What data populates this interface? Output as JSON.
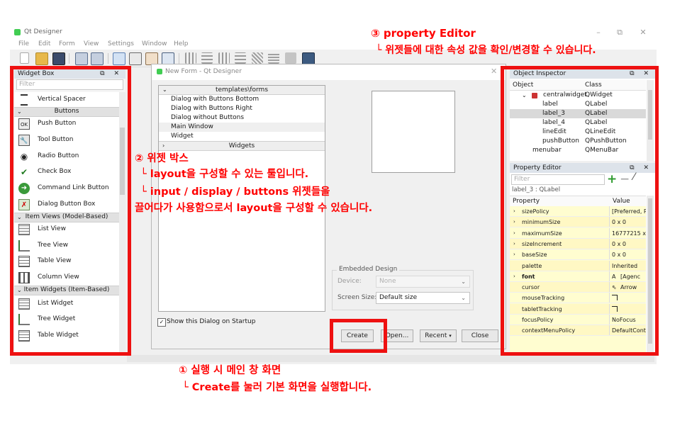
{
  "window": {
    "title": "Qt Designer",
    "controls": {
      "minimize": "–",
      "maximize": "⧉",
      "close": "✕"
    },
    "menu": [
      "File",
      "Edit",
      "Form",
      "View",
      "Settings",
      "Window",
      "Help"
    ]
  },
  "widget_box": {
    "title": "Widget Box",
    "buttons": "⧉ ✕",
    "filter_placeholder": "Filter",
    "spacer_item": {
      "label": "Vertical Spacer",
      "icon": "vertical-spacer-icon"
    },
    "cat_buttons": "Buttons",
    "buttons_items": [
      {
        "label": "Push Button",
        "icon": "push-button-icon",
        "glyph": "OK"
      },
      {
        "label": "Tool Button",
        "icon": "tool-button-icon",
        "glyph": "🔧"
      },
      {
        "label": "Radio Button",
        "icon": "radio-button-icon",
        "glyph": "◉"
      },
      {
        "label": "Check Box",
        "icon": "check-box-icon",
        "glyph": "✔"
      },
      {
        "label": "Command Link Button",
        "icon": "command-link-icon",
        "glyph": "➜"
      },
      {
        "label": "Dialog Button Box",
        "icon": "dialog-button-box-icon",
        "glyph": "✗"
      }
    ],
    "cat_item_views": "Item Views (Model-Based)",
    "item_views": [
      {
        "label": "List View",
        "icon": "list-view-icon"
      },
      {
        "label": "Tree View",
        "icon": "tree-view-icon"
      },
      {
        "label": "Table View",
        "icon": "table-view-icon"
      },
      {
        "label": "Column View",
        "icon": "column-view-icon"
      }
    ],
    "cat_item_widgets": "Item Widgets (Item-Based)",
    "item_widgets": [
      {
        "label": "List Widget",
        "icon": "list-widget-icon"
      },
      {
        "label": "Tree Widget",
        "icon": "tree-widget-icon"
      },
      {
        "label": "Table Widget",
        "icon": "table-widget-icon"
      }
    ]
  },
  "new_form": {
    "title": "New Form - Qt Designer",
    "close": "✕",
    "templates_header": "templates\\forms",
    "templates": [
      "Dialog with Buttons Bottom",
      "Dialog with Buttons Right",
      "Dialog without Buttons",
      "Main Window",
      "Widget"
    ],
    "selected_template": "Main Window",
    "widgets_header": "Widgets",
    "embedded_design": {
      "group_title": "Embedded Design",
      "device_label": "Device:",
      "device_value": "None",
      "screen_size_label": "Screen Size:",
      "screen_size_value": "Default size"
    },
    "show_on_startup": {
      "label": "Show this Dialog on Startup",
      "checked": true
    },
    "buttons": {
      "create": "Create",
      "open": "Open...",
      "recent": "Recent",
      "close": "Close"
    }
  },
  "object_inspector": {
    "title": "Object Inspector",
    "buttons": "⧉ ✕",
    "columns": [
      "Object",
      "Class"
    ],
    "rows": [
      {
        "object": "centralwidget",
        "class": "QWidget",
        "level": 1,
        "expanded": true
      },
      {
        "object": "label",
        "class": "QLabel",
        "level": 2
      },
      {
        "object": "label_3",
        "class": "QLabel",
        "level": 2,
        "selected": true
      },
      {
        "object": "label_4",
        "class": "QLabel",
        "level": 2
      },
      {
        "object": "lineEdit",
        "class": "QLineEdit",
        "level": 2
      },
      {
        "object": "pushButton",
        "class": "QPushButton",
        "level": 2
      },
      {
        "object": "menubar",
        "class": "QMenuBar",
        "level": 1
      }
    ]
  },
  "property_editor": {
    "title": "Property Editor",
    "buttons": "⧉ ✕",
    "filter_placeholder": "Filter",
    "context": "label_3 : QLabel",
    "columns": [
      "Property",
      "Value"
    ],
    "rows": [
      {
        "name": "sizePolicy",
        "value": "[Preferred, P",
        "expandable": true
      },
      {
        "name": "minimumSize",
        "value": "0 x 0",
        "expandable": true
      },
      {
        "name": "maximumSize",
        "value": "16777215 x",
        "expandable": true
      },
      {
        "name": "sizeIncrement",
        "value": "0 x 0",
        "expandable": true
      },
      {
        "name": "baseSize",
        "value": "0 x 0",
        "expandable": true
      },
      {
        "name": "palette",
        "value": "Inherited",
        "expandable": false
      },
      {
        "name": "font",
        "value": "[Agenc",
        "expandable": true,
        "bold": true,
        "glyph": "A"
      },
      {
        "name": "cursor",
        "value": "Arrow",
        "expandable": false,
        "glyph": "⇖"
      },
      {
        "name": "mouseTracking",
        "value": "",
        "expandable": false,
        "checkbox": true
      },
      {
        "name": "tabletTracking",
        "value": "",
        "expandable": false,
        "checkbox": true
      },
      {
        "name": "focusPolicy",
        "value": "NoFocus",
        "expandable": false
      },
      {
        "name": "contextMenuPolicy",
        "value": "DefaultCont",
        "expandable": false
      }
    ]
  },
  "annotations": {
    "property_editor_title": "③ property Editor",
    "property_editor_desc": "└ 위젯들에 대한 속성 값을 확인/변경할 수 있습니다.",
    "widget_box_title": "② 위젯 박스",
    "widget_box_line1": "└ layout을 구성할 수 있는 툴입니다.",
    "widget_box_line2": "└ input / display / buttons 위젯들을",
    "widget_box_line3": "끌어다가 사용함으로서 layout을 구성할 수 있습니다.",
    "main_title": "① 실행 시 메인 창 화면",
    "main_desc": "└ Create를 눌러 기본 화면을 실행합니다."
  },
  "colors": {
    "annotation_red": "#ff0000",
    "selection_gray": "#d9d9d9",
    "property_yellow": "#fffdd0",
    "dock_title_bg": "#dde3ea"
  }
}
